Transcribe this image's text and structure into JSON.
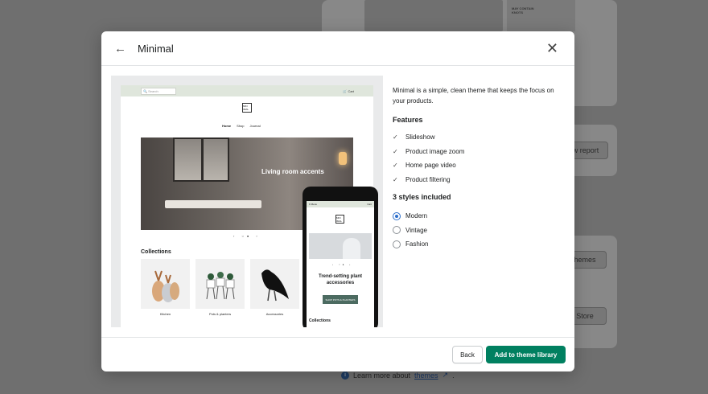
{
  "background": {
    "thumb_text": "MAY CONTAIN KNOTS",
    "view_report_btn": "w report",
    "themes_btn": "hemes",
    "store_btn": "Store",
    "footer_text": "Learn more about",
    "footer_link": "themes",
    "footer_tail": "."
  },
  "modal": {
    "title": "Minimal",
    "description": "Minimal is a simple, clean theme that keeps the focus on your products.",
    "features_heading": "Features",
    "features": [
      "Slideshow",
      "Product image zoom",
      "Home page video",
      "Product filtering"
    ],
    "styles_heading": "3 styles included",
    "styles": [
      {
        "label": "Modern",
        "selected": true
      },
      {
        "label": "Vintage",
        "selected": false
      },
      {
        "label": "Fashion",
        "selected": false
      }
    ],
    "back_button": "Back",
    "add_button": "Add to theme library"
  },
  "preview": {
    "search_placeholder": "Search",
    "cart": "Cart",
    "logo": "MIN IMAL",
    "nav": [
      "Home",
      "Shop",
      "Journal"
    ],
    "hero_text": "Living room accents",
    "collections_heading": "Collections",
    "collections": [
      "Kitchen",
      "Pots & planters",
      "Accessories"
    ],
    "mobile": {
      "menu": "Menu",
      "cart": "Cart",
      "hero_text": "Trend-setting plant accessories",
      "button": "SHOP POTS & PLANTERS",
      "collections_heading": "Collections"
    }
  },
  "colors": {
    "primary": "#008060",
    "radio_selected": "#2c6ecb"
  }
}
